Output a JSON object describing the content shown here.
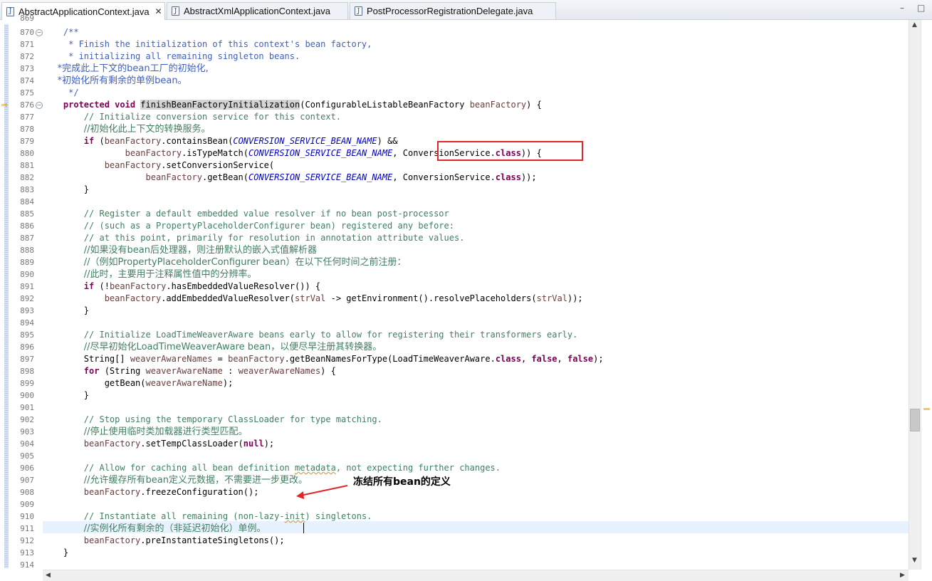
{
  "tabs": [
    {
      "label": "AbstractApplicationContext.java",
      "active": true,
      "close": "✕"
    },
    {
      "label": "AbstractXmlApplicationContext.java",
      "active": false
    },
    {
      "label": "PostProcessorRegistrationDelegate.java",
      "active": false
    }
  ],
  "window_controls": {
    "minimize": "–",
    "maximize": "□"
  },
  "top_partial_line": "869",
  "lines": [
    {
      "num": "870",
      "fold": true
    },
    {
      "num": "871"
    },
    {
      "num": "872"
    },
    {
      "num": "873"
    },
    {
      "num": "874"
    },
    {
      "num": "875"
    },
    {
      "num": "876",
      "fold": true,
      "exec": true
    },
    {
      "num": "877"
    },
    {
      "num": "878"
    },
    {
      "num": "879"
    },
    {
      "num": "880"
    },
    {
      "num": "881"
    },
    {
      "num": "882"
    },
    {
      "num": "883"
    },
    {
      "num": "884"
    },
    {
      "num": "885"
    },
    {
      "num": "886"
    },
    {
      "num": "887"
    },
    {
      "num": "888"
    },
    {
      "num": "889"
    },
    {
      "num": "890"
    },
    {
      "num": "891"
    },
    {
      "num": "892"
    },
    {
      "num": "893"
    },
    {
      "num": "894"
    },
    {
      "num": "895"
    },
    {
      "num": "896"
    },
    {
      "num": "897"
    },
    {
      "num": "898"
    },
    {
      "num": "899"
    },
    {
      "num": "900"
    },
    {
      "num": "901"
    },
    {
      "num": "902"
    },
    {
      "num": "903"
    },
    {
      "num": "904"
    },
    {
      "num": "905"
    },
    {
      "num": "906"
    },
    {
      "num": "907"
    },
    {
      "num": "908"
    },
    {
      "num": "909"
    },
    {
      "num": "910"
    },
    {
      "num": "911",
      "current": true
    },
    {
      "num": "912"
    },
    {
      "num": "913"
    },
    {
      "num": "914"
    }
  ],
  "code": {
    "l870": "    /**",
    "l871": "     * Finish the initialization of this context's bean factory,",
    "l872": "     * initializing all remaining singleton beans.",
    "l873": "     *完成此上下文的bean工厂的初始化,",
    "l874": "     *初始化所有剩余的单例bean。",
    "l875": "     */",
    "l876_kw": "protected void",
    "l876_method": "finishBeanFactoryInitialization",
    "l876_type": "(ConfigurableListableBeanFactory ",
    "l876_param": "beanFactory",
    "l876_end": ") {",
    "l877": "// Initialize conversion service for this context.",
    "l878": "//初始化此上下文的转换服务。",
    "l879_kw": "if",
    "l879_a": " (",
    "l879_p": "beanFactory",
    "l879_b": ".containsBean(",
    "l879_c": "CONVERSION_SERVICE_BEAN_NAME",
    "l879_d": ") &&",
    "l880_p": "beanFactory",
    "l880_b": ".isTypeMatch(",
    "l880_c": "CONVERSION_SERVICE_BEAN_NAME",
    "l880_d": ", ",
    "l880_e": "ConversionService.",
    "l880_kw": "class",
    "l880_f": ")) {",
    "l881_p": "beanFactory",
    "l881_b": ".setConversionService(",
    "l882_p": "beanFactory",
    "l882_b": ".getBean(",
    "l882_c": "CONVERSION_SERVICE_BEAN_NAME",
    "l882_d": ", ConversionService.",
    "l882_kw": "class",
    "l882_e": "));",
    "l883": "}",
    "l885": "// Register a default embedded value resolver if no bean post-processor",
    "l886": "// (such as a PropertyPlaceholderConfigurer bean) registered any before:",
    "l887": "// at this point, primarily for resolution in annotation attribute values.",
    "l888": "//如果没有bean后处理器，则注册默认的嵌入式值解析器",
    "l889": "//（例如PropertyPlaceholderConfigurer bean）在以下任何时间之前注册：",
    "l890": "//此时，主要用于注释属性值中的分辨率。",
    "l891_kw": "if",
    "l891_a": " (!",
    "l891_p": "beanFactory",
    "l891_b": ".hasEmbeddedValueResolver()) {",
    "l892_p": "beanFactory",
    "l892_b": ".addEmbeddedValueResolver(",
    "l892_v": "strVal",
    "l892_c": " -> getEnvironment().resolvePlaceholders(",
    "l892_d": "));",
    "l893": "}",
    "l895": "// Initialize LoadTimeWeaverAware beans early to allow for registering their transformers early.",
    "l896": "//尽早初始化LoadTimeWeaverAware bean，以便尽早注册其转换器。",
    "l897_a": "String[] ",
    "l897_v": "weaverAwareNames",
    "l897_b": " = ",
    "l897_p": "beanFactory",
    "l897_c": ".getBeanNamesForType(LoadTimeWeaverAware.",
    "l897_kw1": "class",
    "l897_d": ", ",
    "l897_kw2": "false",
    "l897_e": ", ",
    "l897_kw3": "false",
    "l897_f": ");",
    "l898_kw": "for",
    "l898_a": " (String ",
    "l898_v": "weaverAwareName",
    "l898_b": " : ",
    "l898_v2": "weaverAwareNames",
    "l898_c": ") {",
    "l899_a": "getBean(",
    "l899_v": "weaverAwareName",
    "l899_b": ");",
    "l900": "}",
    "l902": "// Stop using the temporary ClassLoader for type matching.",
    "l903": "//停止使用临时类加载器进行类型匹配。",
    "l904_p": "beanFactory",
    "l904_a": ".setTempClassLoader(",
    "l904_kw": "null",
    "l904_b": ");",
    "l906_a": "// Allow for caching all bean definition ",
    "l906_w": "metadata",
    "l906_b": ", not expecting further changes.",
    "l907": "//允许缓存所有bean定义元数据，不需要进一步更改。",
    "l908_p": "beanFactory",
    "l908_a": ".freezeConfiguration();",
    "l910_a": "// Instantiate all remaining (non-lazy-",
    "l910_w": "init",
    "l910_b": ") singletons.",
    "l911": "//实例化所有剩余的（非延迟初始化）单例。",
    "l912_p": "beanFactory",
    "l912_a": ".preInstantiateSingletons();",
    "l913": "}"
  },
  "annotation": {
    "note": "冻结所有bean的定义",
    "box_color": "#e0262a",
    "arrow_color": "#e0262a"
  },
  "scrollbar": {
    "up": "▲",
    "down": "▼",
    "left": "◀",
    "right": "▶"
  }
}
